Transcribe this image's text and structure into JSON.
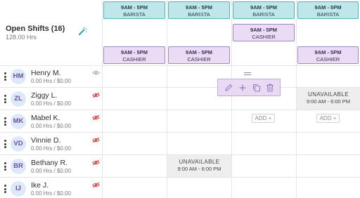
{
  "open_shifts": {
    "title": "Open Shifts (16)",
    "hours": "128.00 Hrs"
  },
  "shifts": {
    "barista_1": {
      "time": "9AM - 5PM",
      "role": "BARISTA"
    },
    "barista_2": {
      "time": "9AM - 5PM",
      "role": "BARISTA"
    },
    "barista_3": {
      "time": "9AM - 5PM",
      "role": "BARISTA"
    },
    "barista_4": {
      "time": "9AM - 5PM",
      "role": "BARISTA"
    },
    "cashier_1": {
      "time": "9AM - 5PM",
      "role": "CASHIER"
    },
    "cashier_2": {
      "time": "9AM - 5PM",
      "role": "CASHIER"
    },
    "cashier_3": {
      "time": "9AM - 5PM",
      "role": "CASHIER"
    },
    "cashier_4": {
      "time": "9AM - 5PM",
      "role": "CASHIER"
    }
  },
  "employees": [
    {
      "initials": "HM",
      "name": "Henry M.",
      "hours": "0.00 Hrs / $0.00",
      "visibility": "eye-icon"
    },
    {
      "initials": "ZL",
      "name": "Ziggy L.",
      "hours": "0.00 Hrs / $0.00",
      "visibility": "eye-off-icon"
    },
    {
      "initials": "MK",
      "name": "Mabel K.",
      "hours": "0.00 Hrs / $0.00",
      "visibility": "eye-off-icon"
    },
    {
      "initials": "VD",
      "name": "Vinnie D.",
      "hours": "0.00 Hrs / $0.00",
      "visibility": "eye-off-icon"
    },
    {
      "initials": "BR",
      "name": "Bethany R.",
      "hours": "0.00 Hrs / $0.00",
      "visibility": "eye-off-icon"
    },
    {
      "initials": "IJ",
      "name": "Ike J.",
      "hours": "0.00 Hrs / $0.00",
      "visibility": "eye-off-icon"
    }
  ],
  "unavailable": {
    "ziggy": {
      "label": "UNAVAILABLE",
      "time": "9:00 AM - 6:00 PM"
    },
    "bethany": {
      "label": "UNAVAILABLE",
      "time": "9:00 AM - 6:00 PM"
    }
  },
  "add_label": "ADD +",
  "toolbar": {
    "icons": [
      "pencil-icon",
      "plus-icon",
      "copy-icon",
      "trash-icon"
    ]
  },
  "colors": {
    "barista_fill": "#bfe7ea",
    "barista_border": "#4fb6bf",
    "cashier_fill": "#e9dcf4",
    "cashier_border": "#a486c6",
    "avatar_text": "#6b4fa1",
    "eye_off": "#d33a3a"
  }
}
